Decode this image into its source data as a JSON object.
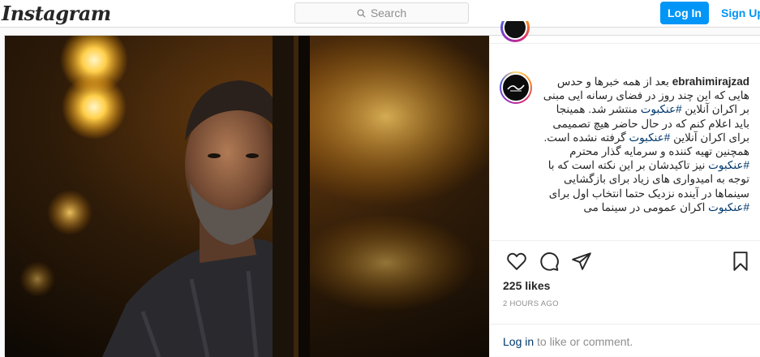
{
  "header": {
    "logo": "Instagram",
    "search_placeholder": "Search",
    "login_label": "Log In",
    "signup_label": "Sign Up"
  },
  "post": {
    "username": "ebrahimirajzad",
    "caption_parts": [
      "بعد از همه خبرها و حدس هایی که این چند روز در فضای رسانه ایی مبنی بر اکران آنلاین ",
      "#عنکبوت",
      " منتشر شد. همینجا باید اعلام کنم که در حال حاضر هیچ تصمیمی برای اکران آنلاین ",
      "#عنکبوت",
      " گرفته نشده است. همچنین تهیه کننده و سرمایه گذار محترم ",
      "#عنکبوت",
      " نیز تاکیدشان بر این نکته است که با توجه به امیدواری های زیاد برای بازگشایی سینماها در آینده نزدیک حتما انتخاب اول برای ",
      "#عنکبوت",
      " اکران عمومی در سینما می"
    ],
    "likes": "225 likes",
    "time": "2 HOURS AGO",
    "comment_link": "Log in",
    "comment_rest": " to like or comment."
  },
  "icons": [
    "heart-icon",
    "comment-icon",
    "share-icon",
    "bookmark-icon",
    "search-icon"
  ]
}
